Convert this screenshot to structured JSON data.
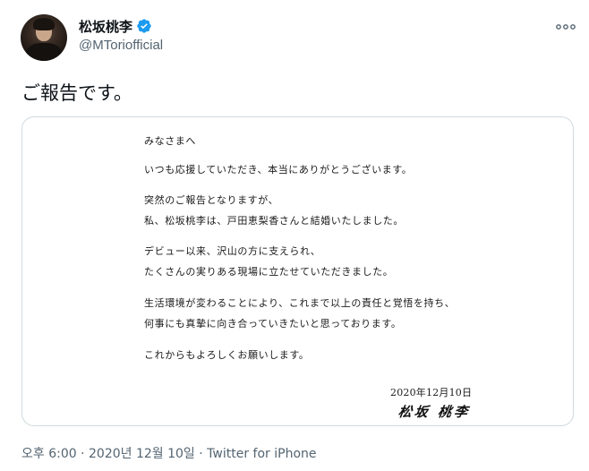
{
  "author": {
    "display_name": "松坂桃李",
    "handle": "@MToriofficial",
    "verified": true
  },
  "tweet": {
    "text": "ご報告です。"
  },
  "letter": {
    "lines": [
      "みなさまへ",
      "いつも応援していただき、本当にありがとうございます。",
      "突然のご報告となりますが、",
      "私、松坂桃李は、戸田恵梨香さんと結婚いたしました。",
      "デビュー以来、沢山の方に支えられ、",
      "たくさんの実りある現場に立たせていただきました。",
      "生活環境が変わることにより、これまで以上の責任と覚悟を持ち、",
      "何事にも真摯に向き合っていきたいと思っております。",
      "これからもよろしくお願いします。"
    ],
    "date": "2020年12月10日",
    "signature": "松坂 桃李"
  },
  "meta": {
    "timestamp": "오후 6:00 · 2020년 12월 10일",
    "separator": " · ",
    "source": "Twitter for iPhone"
  },
  "colors": {
    "verified": "#1d9bf0",
    "secondary_text": "#536471",
    "border": "#cfd9de"
  },
  "icons": {
    "more": "more-dots-icon",
    "verified": "verified-badge-icon"
  }
}
